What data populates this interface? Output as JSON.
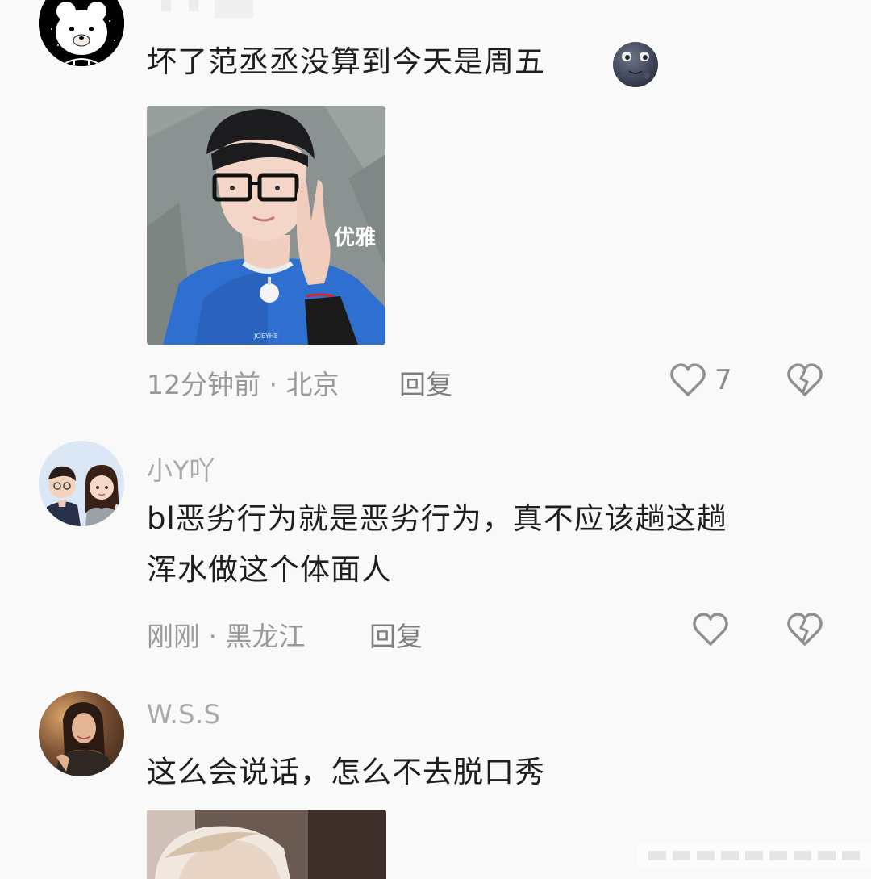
{
  "colors": {
    "background": "#f9f9f9",
    "text": "#1e1e1e",
    "muted": "#9a9a9a",
    "icon": "#8f8f8f"
  },
  "comments": [
    {
      "username": "",
      "text_lines": [
        "坏了范丞丞没算到今天是周五"
      ],
      "emoji": "new-moon-face",
      "image_caption": "优雅",
      "shirt_text": "JOEYHE",
      "time": "12分钟前",
      "location": "北京",
      "reply_label": "回复",
      "likes": "7",
      "icons": {
        "like": "heart-outline-icon",
        "dislike": "broken-heart-icon"
      }
    },
    {
      "username": "小Y吖",
      "text_lines": [
        "bl恶劣行为就是恶劣行为，真不应该趟这趟",
        "浑水做这个体面人"
      ],
      "time": "刚刚",
      "location": "黑龙江",
      "reply_label": "回复",
      "icons": {
        "like": "heart-outline-icon",
        "dislike": "broken-heart-icon"
      }
    },
    {
      "username": "W.S.S",
      "text_lines": [
        "这么会说话，怎么不去脱口秀"
      ]
    }
  ]
}
